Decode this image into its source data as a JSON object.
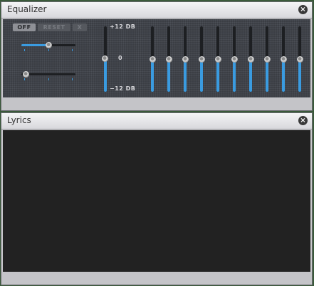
{
  "equalizer": {
    "title": "Equalizer",
    "buttons": {
      "off": "OFF",
      "reset": "RESET",
      "x": "X"
    },
    "scale": {
      "top": "+12 DB",
      "mid": "0",
      "bottom": "−12 DB"
    },
    "balance_level": 0.5,
    "preamp_level": 0.0,
    "bands_level_db": [
      0,
      0,
      0,
      0,
      0,
      0,
      0,
      0,
      0,
      0
    ]
  },
  "lyrics": {
    "title": "Lyrics"
  },
  "colors": {
    "accent": "#3a9be0",
    "panel_dark": "#3b3e44",
    "lyrics_bg": "#222222"
  }
}
